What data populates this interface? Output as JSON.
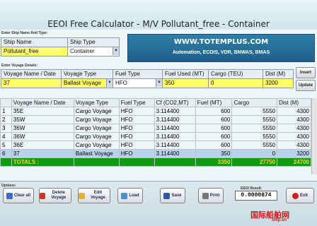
{
  "window": {
    "title": "EEOI Free Calculator - M/V Pollutant_free - Container"
  },
  "ship_section": {
    "label": "Enter Ship Name And Type:",
    "headers": [
      "Ship Name",
      "Ship Type"
    ],
    "ship_name": "Pollutant_free",
    "ship_type": "Container"
  },
  "brand": {
    "website": "WWW.TOTEMPLUS.COM",
    "subtitle": "Automation, ECDIS, VDR, BNWAS, BMAS"
  },
  "voyage_section": {
    "label": "Enter Voyage Details:",
    "headers": [
      "Voyage Name / Date",
      "Voyage Type",
      "Fuel Type",
      "Fuel Used (MT)",
      "Cargo (TEU)",
      "Dist (M)"
    ],
    "values": [
      "37",
      "Ballast Voyage",
      "HFO",
      "350",
      "0",
      "3200"
    ],
    "insert_label": "Insert",
    "update_label": "Update"
  },
  "grid": {
    "headers": [
      "",
      "Voyage Name / Date",
      "Voyage Type",
      "Fuel Type",
      "Cf (CO2,MT)",
      "Fuel (MT)",
      "Cargo",
      "Dist (M)"
    ],
    "rows": [
      [
        "1",
        "35E",
        "Cargo Voyage",
        "HFO",
        "3.114400",
        "600",
        "5550",
        "4300"
      ],
      [
        "2",
        "35W",
        "Cargo Voyage",
        "HFO",
        "3.114400",
        "600",
        "5550",
        "4300"
      ],
      [
        "3",
        "36W",
        "Cargo Voyage",
        "HFO",
        "3.114400",
        "600",
        "5550",
        "4300"
      ],
      [
        "4",
        "36W",
        "Cargo Voyage",
        "HFO",
        "3.114400",
        "600",
        "5550",
        "4300"
      ],
      [
        "5",
        "36E",
        "Cargo Voyage",
        "HFO",
        "3.114400",
        "600",
        "5550",
        "4300"
      ],
      [
        "6",
        "37",
        "Ballast Voyage",
        "HFO",
        "3.114400",
        "350",
        "0",
        "3200"
      ]
    ],
    "totals": {
      "label": "TOTALS :",
      "fuel": "3350",
      "cargo": "27750",
      "dist": "24700"
    }
  },
  "options": {
    "label": "Options:",
    "clear_all": "Clear all",
    "delete_voyage": "Delete Voyage",
    "edit_voyage": "Edit Voyage",
    "load": "Load",
    "save": "Save",
    "print": "Print",
    "exit": "Exit",
    "result_label": "EEOI Result:",
    "result_value": "0.0000874"
  },
  "watermark": {
    "text": "国际船舶网",
    "sub": "ship.sh"
  },
  "colors": {
    "highlight_input": "#ffff66",
    "totals_row": "#109a10",
    "totals_text": "#ffd23a",
    "brand_panel": "#1e6089"
  }
}
